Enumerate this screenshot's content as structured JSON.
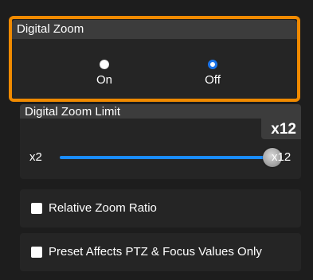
{
  "digital_zoom": {
    "title": "Digital Zoom",
    "options": [
      {
        "label": "On",
        "selected": false
      },
      {
        "label": "Off",
        "selected": true
      }
    ]
  },
  "zoom_limit": {
    "title": "Digital Zoom Limit",
    "value": "x12",
    "min_label": "x2",
    "max_label": "x12",
    "slider_level": 1.0
  },
  "options": {
    "relative_zoom_ratio": {
      "label": "Relative Zoom Ratio",
      "checked": false
    },
    "preset_affects": {
      "label": "Preset Affects PTZ & Focus Values Only",
      "checked": false
    }
  },
  "colors": {
    "highlight": "#f08a00",
    "accent": "#1a8cff",
    "background": "#1d1d1d",
    "section": "#252525",
    "header": "#3c3c3c"
  }
}
